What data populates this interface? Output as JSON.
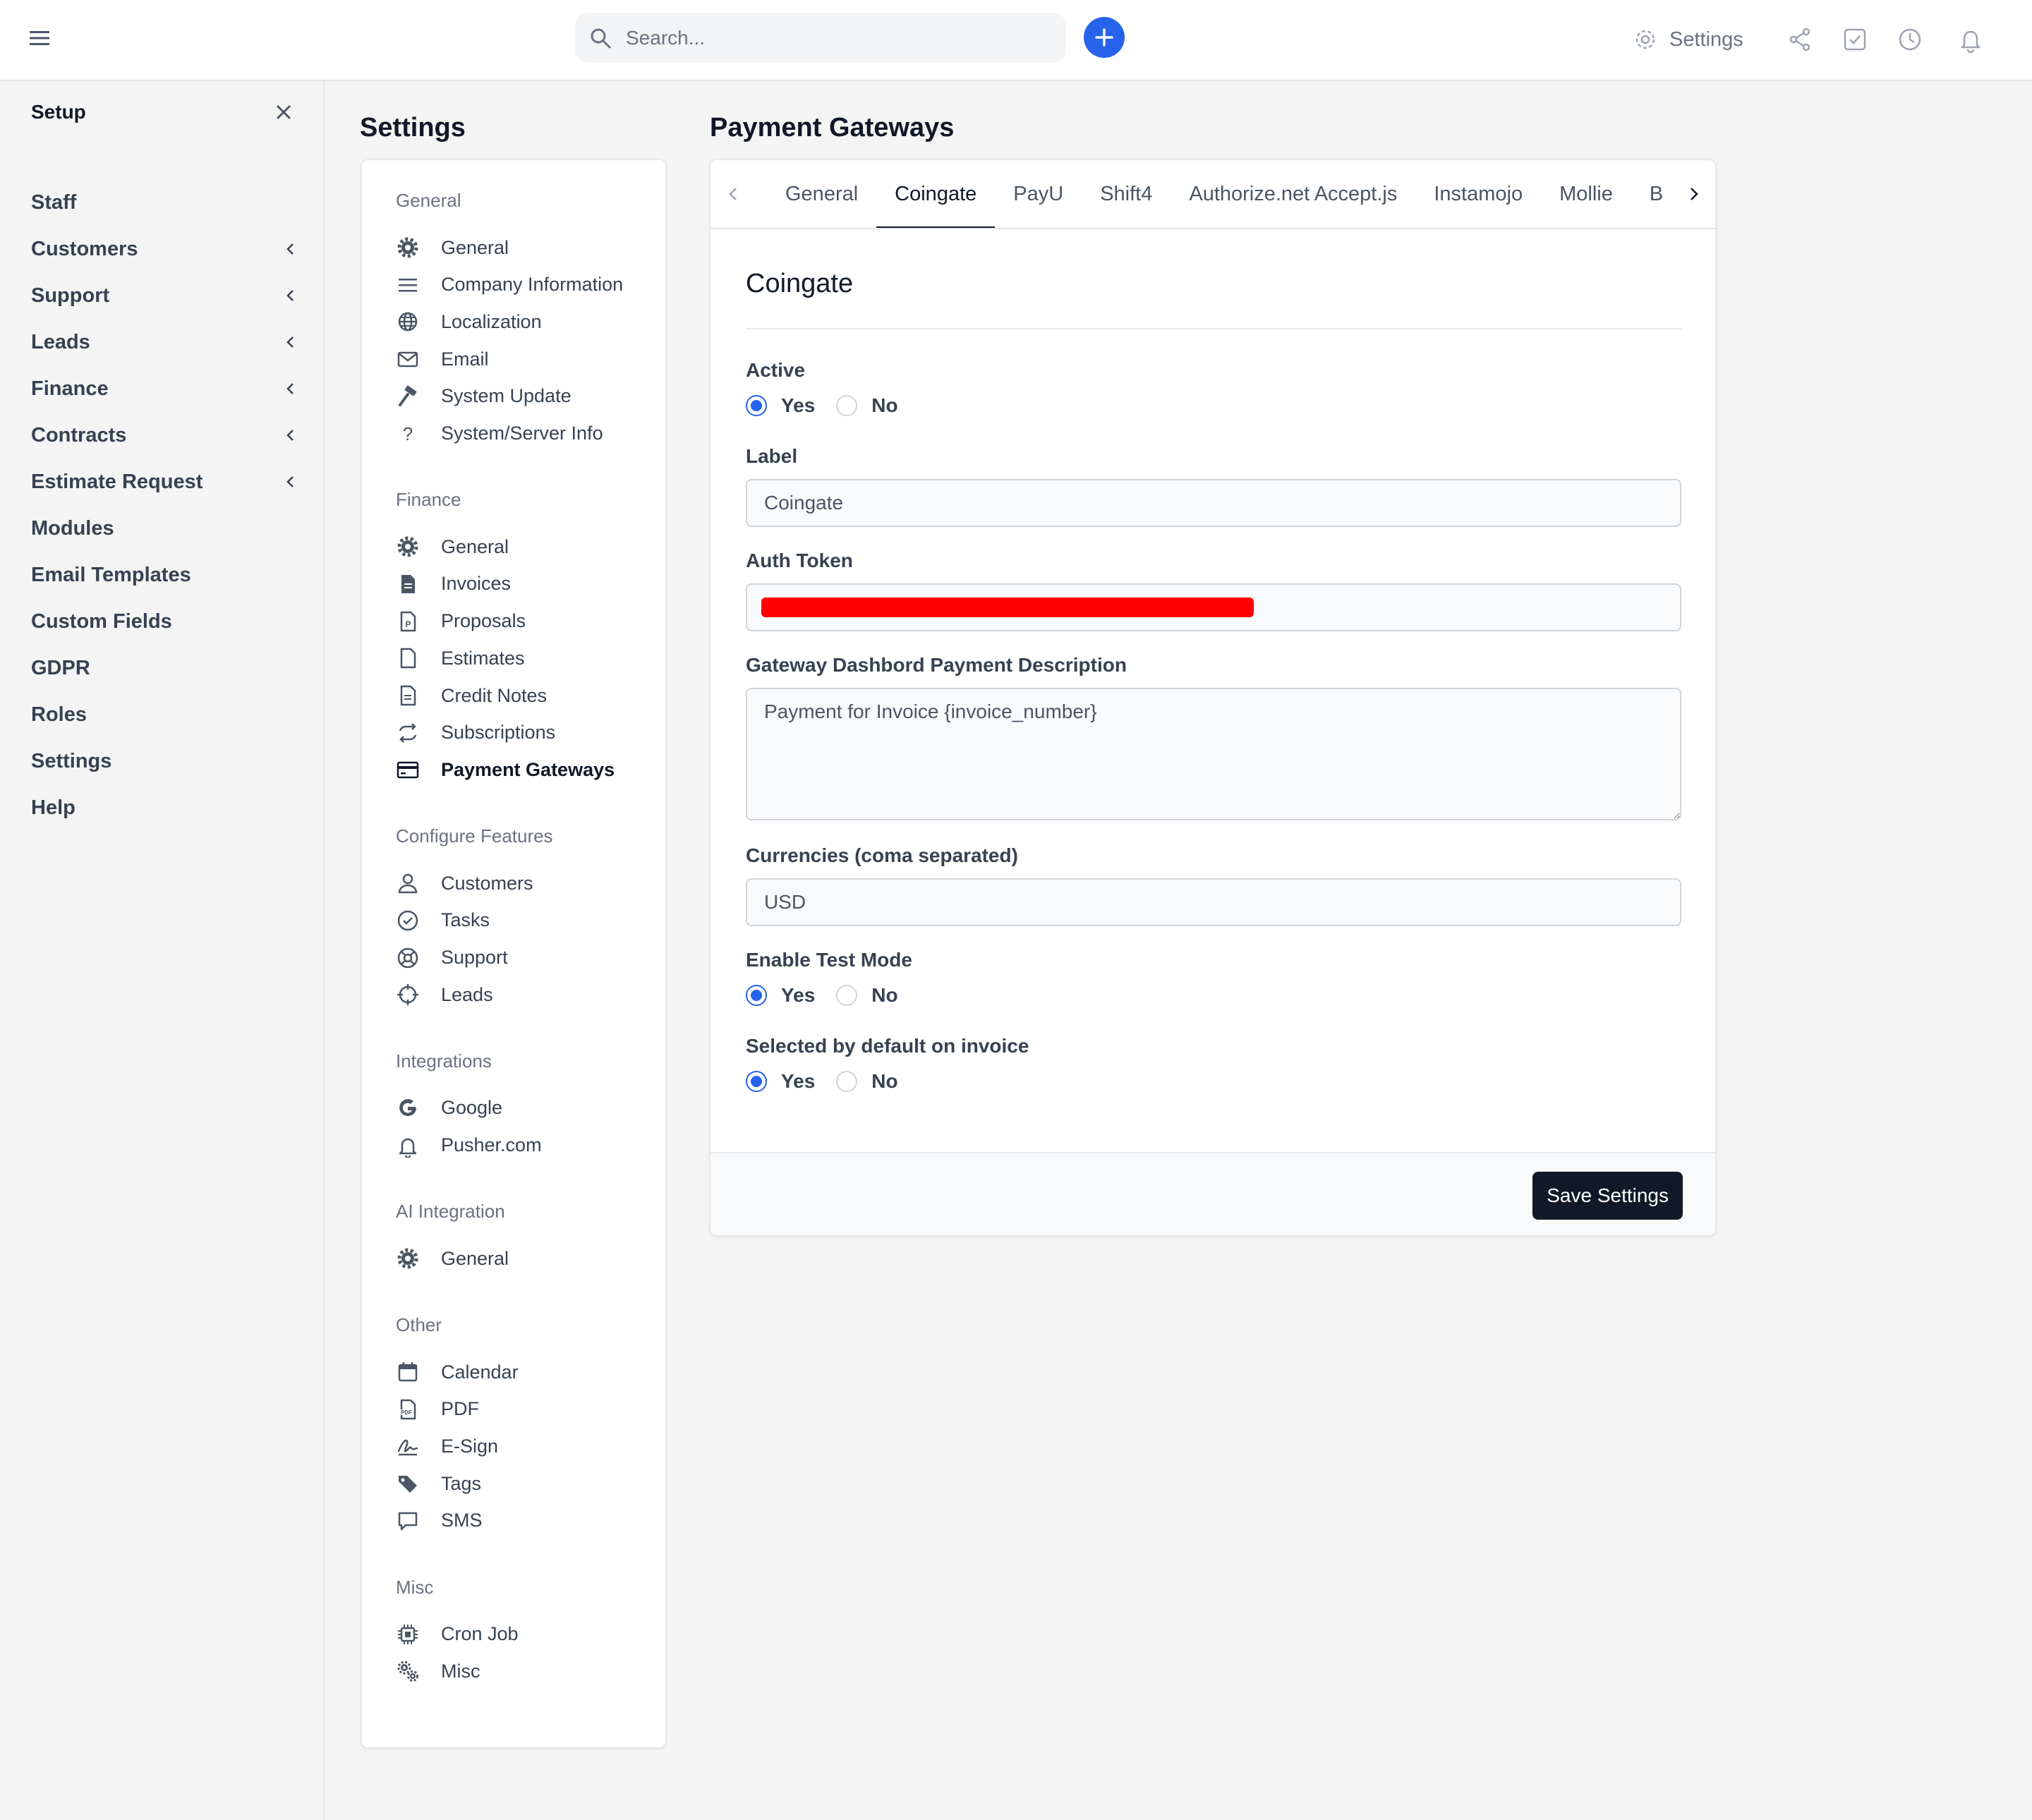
{
  "topbar": {
    "search_placeholder": "Search...",
    "settings_label": "Settings",
    "icons": [
      "menu-icon",
      "search-icon",
      "plus-icon",
      "gear-icon",
      "share-icon",
      "checkbox-icon",
      "clock-icon",
      "bell-icon"
    ],
    "accent_color": "#2563eb"
  },
  "sidebar": {
    "title": "Setup",
    "items": [
      {
        "label": "Staff",
        "chevron": false
      },
      {
        "label": "Customers",
        "chevron": true
      },
      {
        "label": "Support",
        "chevron": true
      },
      {
        "label": "Leads",
        "chevron": true
      },
      {
        "label": "Finance",
        "chevron": true
      },
      {
        "label": "Contracts",
        "chevron": true
      },
      {
        "label": "Estimate Request",
        "chevron": true
      },
      {
        "label": "Modules",
        "chevron": false
      },
      {
        "label": "Email Templates",
        "chevron": false
      },
      {
        "label": "Custom Fields",
        "chevron": false
      },
      {
        "label": "GDPR",
        "chevron": false
      },
      {
        "label": "Roles",
        "chevron": false
      },
      {
        "label": "Settings",
        "chevron": false
      },
      {
        "label": "Help",
        "chevron": false
      }
    ]
  },
  "settings": {
    "title": "Settings",
    "groups": [
      {
        "title": "General",
        "items": [
          {
            "label": "General",
            "icon": "gear-icon"
          },
          {
            "label": "Company Information",
            "icon": "lines-icon"
          },
          {
            "label": "Localization",
            "icon": "globe-icon"
          },
          {
            "label": "Email",
            "icon": "envelope-icon"
          },
          {
            "label": "System Update",
            "icon": "hammer-icon"
          },
          {
            "label": "System/Server Info",
            "icon": "question-icon"
          }
        ]
      },
      {
        "title": "Finance",
        "items": [
          {
            "label": "General",
            "icon": "gear-icon"
          },
          {
            "label": "Invoices",
            "icon": "file-icon"
          },
          {
            "label": "Proposals",
            "icon": "file-p-icon"
          },
          {
            "label": "Estimates",
            "icon": "file-outline-icon"
          },
          {
            "label": "Credit Notes",
            "icon": "file-text-icon"
          },
          {
            "label": "Subscriptions",
            "icon": "repeat-icon"
          },
          {
            "label": "Payment Gateways",
            "icon": "credit-card-icon",
            "active": true
          }
        ]
      },
      {
        "title": "Configure Features",
        "items": [
          {
            "label": "Customers",
            "icon": "user-icon"
          },
          {
            "label": "Tasks",
            "icon": "check-circle-icon"
          },
          {
            "label": "Support",
            "icon": "lifebuoy-icon"
          },
          {
            "label": "Leads",
            "icon": "crosshair-icon"
          }
        ]
      },
      {
        "title": "Integrations",
        "items": [
          {
            "label": "Google",
            "icon": "google-icon"
          },
          {
            "label": "Pusher.com",
            "icon": "bell-icon"
          }
        ]
      },
      {
        "title": "AI Integration",
        "items": [
          {
            "label": "General",
            "icon": "gear-icon"
          }
        ]
      },
      {
        "title": "Other",
        "items": [
          {
            "label": "Calendar",
            "icon": "calendar-icon"
          },
          {
            "label": "PDF",
            "icon": "pdf-icon"
          },
          {
            "label": "E-Sign",
            "icon": "signature-icon"
          },
          {
            "label": "Tags",
            "icon": "tags-icon"
          },
          {
            "label": "SMS",
            "icon": "chat-icon"
          }
        ]
      },
      {
        "title": "Misc",
        "items": [
          {
            "label": "Cron Job",
            "icon": "chip-icon"
          },
          {
            "label": "Misc",
            "icon": "gears-icon"
          }
        ]
      }
    ]
  },
  "gateway": {
    "title": "Payment Gateways",
    "tabs": [
      "General",
      "Coingate",
      "PayU",
      "Shift4",
      "Authorize.net Accept.js",
      "Instamojo",
      "Mollie",
      "Braintree"
    ],
    "active_tab": "Coingate",
    "section_heading": "Coingate",
    "fields": {
      "active_label": "Active",
      "label_label": "Label",
      "label_value": "Coingate",
      "auth_token_label": "Auth Token",
      "description_label": "Gateway Dashbord Payment Description",
      "description_value": "Payment for Invoice {invoice_number}",
      "currencies_label": "Currencies (coma separated)",
      "currencies_value": "USD",
      "test_mode_label": "Enable Test Mode",
      "default_label": "Selected by default on invoice",
      "yes": "Yes",
      "no": "No"
    },
    "radios": {
      "active": "yes",
      "test_mode": "yes",
      "default": "yes"
    },
    "save_label": "Save Settings"
  }
}
